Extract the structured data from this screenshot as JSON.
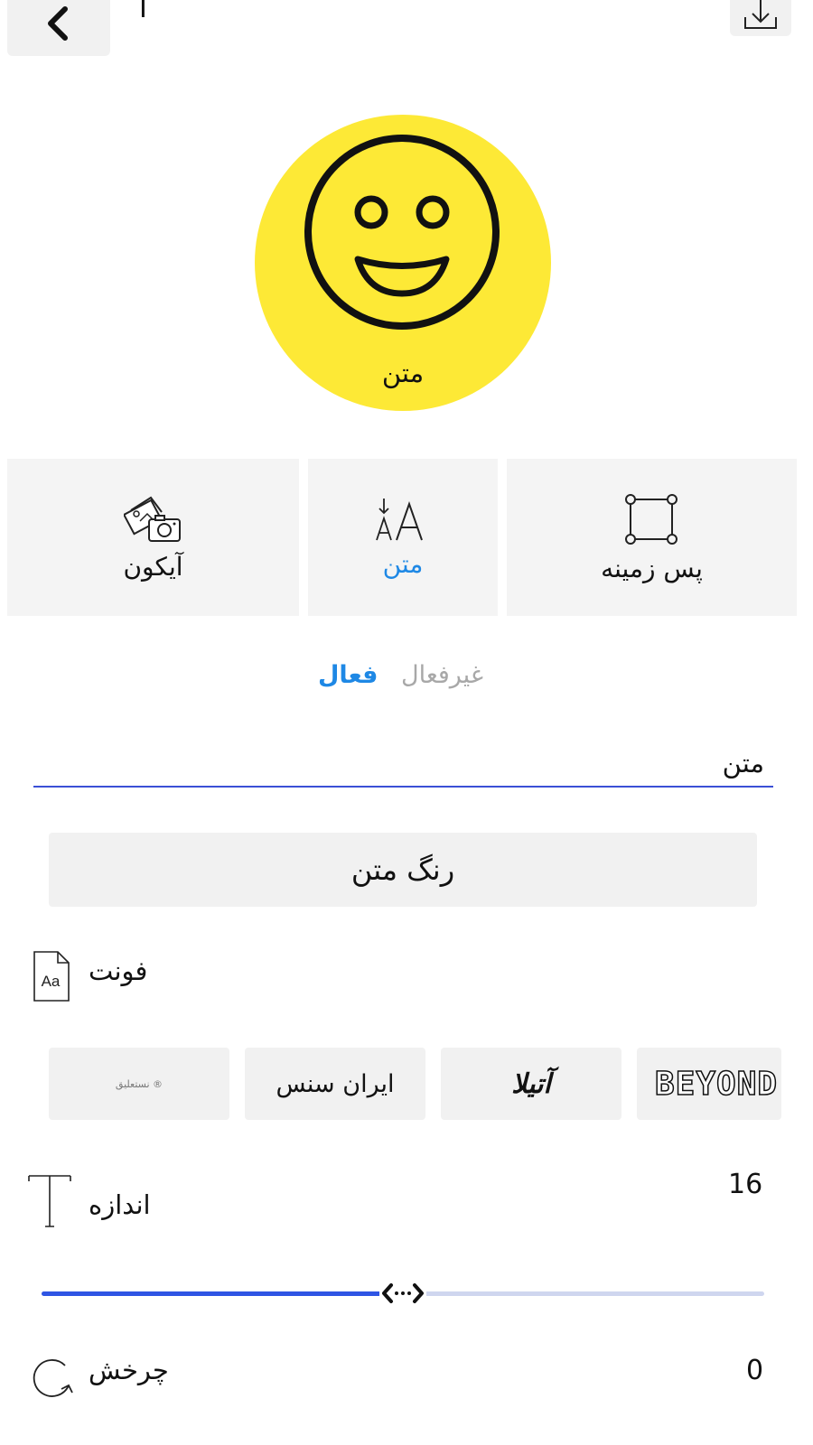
{
  "header": {
    "title": "I",
    "back_icon": "chevron-left-icon",
    "download_icon": "download-icon"
  },
  "preview": {
    "label": "متن",
    "background_color": "#fde936",
    "icon": "smiley-icon"
  },
  "tabs": [
    {
      "label": "آیکون",
      "icon": "photo-camera-icon",
      "active": false
    },
    {
      "label": "متن",
      "icon": "text-size-icon",
      "active": true
    },
    {
      "label": "پس زمینه",
      "icon": "frame-icon",
      "active": false
    }
  ],
  "status": {
    "active": "فعال",
    "inactive": "غیرفعال"
  },
  "text_field": {
    "value": "متن"
  },
  "color_button": {
    "label": "رنگ متن"
  },
  "font": {
    "label": "فونت",
    "icon": "font-file-icon",
    "options": [
      {
        "label": "نستعلیق ®",
        "selected": false
      },
      {
        "label": "ایران سنس",
        "selected": false
      },
      {
        "label": "آتیلا",
        "selected": false
      },
      {
        "label": "BEYOND",
        "selected": false
      }
    ]
  },
  "size": {
    "label": "اندازه",
    "value": "16",
    "icon": "text-size-t-icon",
    "slider_fraction": 0.5
  },
  "rotation": {
    "label": "چرخش",
    "value": "0",
    "icon": "rotate-icon"
  },
  "colors": {
    "accent": "#1e88e5",
    "slider_active": "#2f55e4",
    "slider_inactive": "#cfd6ef",
    "tile_bg": "#f4f4f4"
  }
}
